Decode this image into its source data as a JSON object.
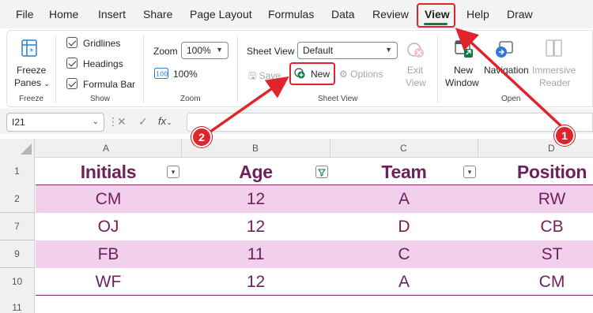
{
  "menu": {
    "tabs": [
      "File",
      "Home",
      "Insert",
      "Share",
      "Page Layout",
      "Formulas",
      "Data",
      "Review",
      "View",
      "Help",
      "Draw"
    ],
    "active": "View"
  },
  "ribbon": {
    "freeze": {
      "label_line1": "Freeze",
      "label_line2": "Panes",
      "group": "Freeze"
    },
    "show": {
      "gridlines": "Gridlines",
      "headings": "Headings",
      "formula_bar": "Formula Bar",
      "group": "Show"
    },
    "zoom": {
      "label": "Zoom",
      "value": "100%",
      "to100": "100%",
      "group": "Zoom"
    },
    "sheet_view": {
      "label": "Sheet View",
      "value": "Default",
      "save": "Save",
      "new": "New",
      "options": "Options",
      "exit_line1": "Exit",
      "exit_line2": "View",
      "group": "Sheet View"
    },
    "open": {
      "new_window_line1": "New",
      "new_window_line2": "Window",
      "navigation": "Navigation",
      "immersive_line1": "Immersive",
      "immersive_line2": "Reader",
      "group": "Open"
    }
  },
  "formula_bar": {
    "name_box": "I21",
    "fx": "fx"
  },
  "grid": {
    "columns": [
      "A",
      "B",
      "C",
      "D"
    ],
    "header_row_number": "1",
    "headers": [
      "Initials",
      "Age",
      "Team",
      "Position"
    ],
    "rows": [
      {
        "num": "2",
        "cells": [
          "CM",
          "12",
          "A",
          "RW"
        ]
      },
      {
        "num": "7",
        "cells": [
          "OJ",
          "12",
          "D",
          "CB"
        ]
      },
      {
        "num": "9",
        "cells": [
          "FB",
          "11",
          "C",
          "ST"
        ]
      },
      {
        "num": "10",
        "cells": [
          "WF",
          "12",
          "A",
          "CM"
        ]
      }
    ],
    "trailing_row_number": "11"
  },
  "callouts": [
    "1",
    "2"
  ],
  "colors": {
    "accent": "#107c41",
    "band": "#f2d0ec",
    "text": "#6e1f5c",
    "callout": "#e0242b"
  }
}
